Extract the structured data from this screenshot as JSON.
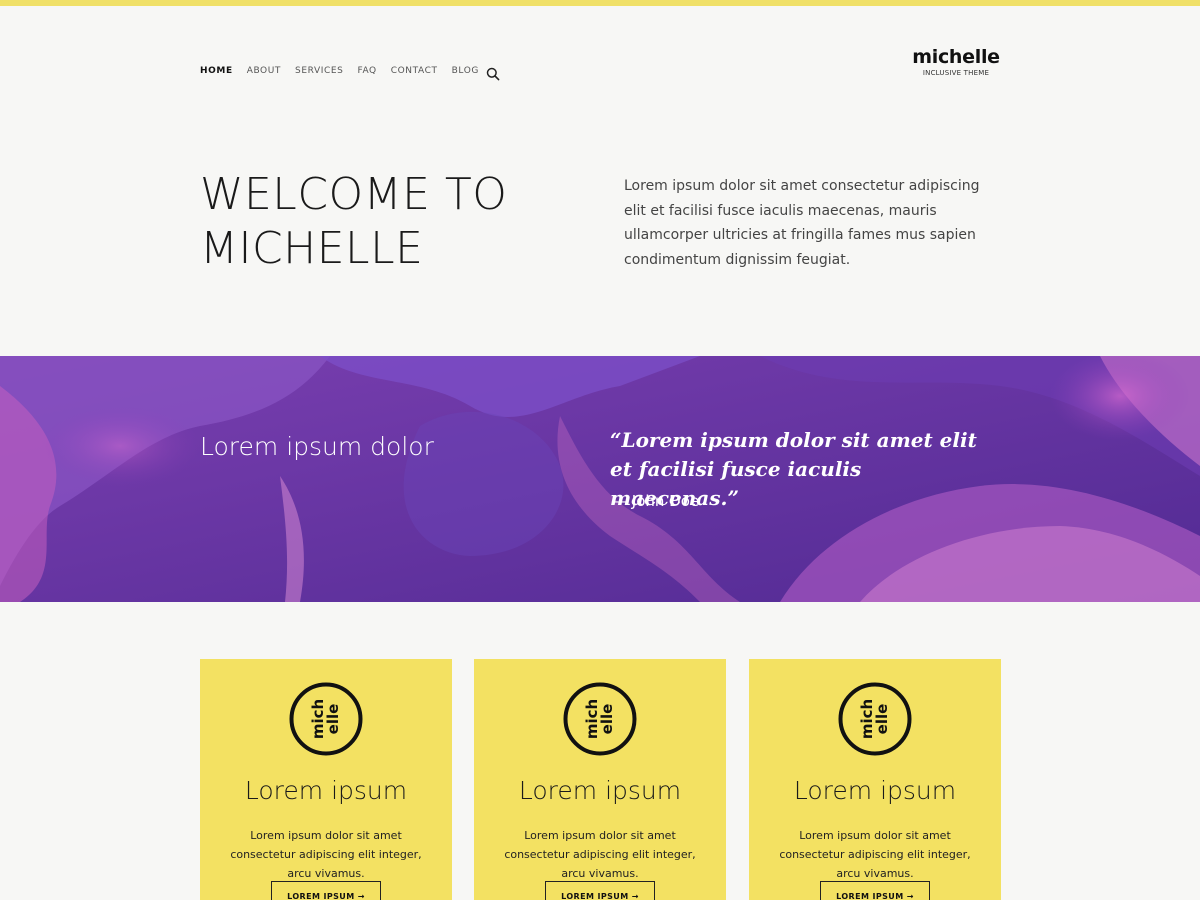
{
  "header": {
    "nav": [
      "HOME",
      "ABOUT",
      "SERVICES",
      "FAQ",
      "CONTACT",
      "BLOG"
    ],
    "active_item": "HOME",
    "search_icon": "search-icon",
    "brand_name": "michelle",
    "brand_tagline": "INCLUSIVE THEME"
  },
  "intro": {
    "heading": "WELCOME TO MICHELLE",
    "text": "Lorem ipsum dolor sit amet consectetur adipiscing elit et facilisi fusce iaculis maecenas, mauris ullamcorper ultricies at fringilla fames mus sapien condimentum dignissim feugiat."
  },
  "banner": {
    "heading": "Lorem ipsum dolor",
    "quote": "“Lorem ipsum dolor sit amet elit et facilisi fusce iaculis maecenas.”",
    "author": "— John Doe"
  },
  "cards": [
    {
      "logo_text": "michelle",
      "title": "Lorem ipsum",
      "text": "Lorem ipsum dolor sit amet consectetur adipiscing elit integer, arcu vivamus.",
      "button": "LOREM IPSUM →"
    },
    {
      "logo_text": "michelle",
      "title": "Lorem ipsum",
      "text": "Lorem ipsum dolor sit amet consectetur adipiscing elit integer, arcu vivamus.",
      "button": "LOREM IPSUM →"
    },
    {
      "logo_text": "michelle",
      "title": "Lorem ipsum",
      "text": "Lorem ipsum dolor sit amet consectetur adipiscing elit integer, arcu vivamus.",
      "button": "LOREM IPSUM →"
    }
  ],
  "colors": {
    "accent_yellow": "#f3e162",
    "banner_purple": "#5a2d98",
    "text_dark": "#1a1a1a"
  }
}
